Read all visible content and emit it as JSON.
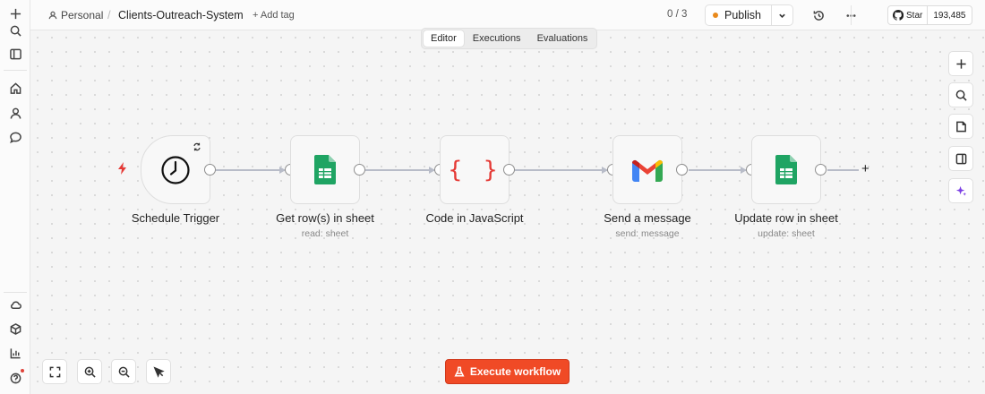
{
  "header": {
    "project": "Personal",
    "workflow_name": "Clients-Outreach-System",
    "add_tag": "+ Add tag",
    "counter": "0 / 3",
    "publish_label": "Publish",
    "github_star": "Star",
    "github_count": "193,485"
  },
  "tabs": [
    {
      "label": "Editor",
      "active": true
    },
    {
      "label": "Executions",
      "active": false
    },
    {
      "label": "Evaluations",
      "active": false
    }
  ],
  "nodes": [
    {
      "title": "Schedule Trigger",
      "subtitle": "",
      "icon": "clock-icon"
    },
    {
      "title": "Get row(s) in sheet",
      "subtitle": "read: sheet",
      "icon": "google-sheets-icon"
    },
    {
      "title": "Code in JavaScript",
      "subtitle": "",
      "icon": "code-braces-icon"
    },
    {
      "title": "Send a message",
      "subtitle": "send: message",
      "icon": "gmail-icon"
    },
    {
      "title": "Update row in sheet",
      "subtitle": "update: sheet",
      "icon": "google-sheets-icon"
    }
  ],
  "canvas": {
    "braces": "{ }",
    "add_node": "+"
  },
  "footer": {
    "execute_label": "Execute workflow"
  },
  "colors": {
    "accent": "#f04a26",
    "publish_dot": "#e98a1c",
    "sheets_green": "#1fa463",
    "code_red": "#e53935"
  }
}
